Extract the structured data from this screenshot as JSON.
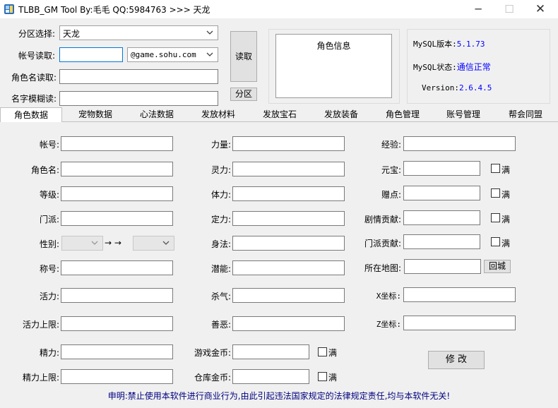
{
  "window": {
    "title": "TLBB_GM Tool By:毛毛 QQ:5984763 >>> 天龙",
    "minimize_label": "─",
    "maximize_label": "☐",
    "close_label": "✕"
  },
  "login": {
    "partition_label": "分区选择:",
    "partition_value": "天龙",
    "account_label": "帐号读取:",
    "account_value": "",
    "domain_value": "@game.sohu.com",
    "role_name_label": "角色名读取:",
    "role_name_value": "",
    "fuzzy_label": "名字模糊读:",
    "fuzzy_value": "",
    "read_button": "读取",
    "partition_button": "分区"
  },
  "role_info": {
    "header": "角色信息"
  },
  "mysql": {
    "version_label": "MySQL版本:",
    "version_value": "5.1.73",
    "status_label": "MySQL状态:",
    "status_value": "通信正常",
    "tool_version_label": "Version:",
    "tool_version_value": "2.6.4.5"
  },
  "tabs": [
    {
      "label": "角色数据",
      "active": true
    },
    {
      "label": "宠物数据",
      "active": false
    },
    {
      "label": "心法数据",
      "active": false
    },
    {
      "label": "发放材料",
      "active": false
    },
    {
      "label": "发放宝石",
      "active": false
    },
    {
      "label": "发放装备",
      "active": false
    },
    {
      "label": "角色管理",
      "active": false
    },
    {
      "label": "账号管理",
      "active": false
    },
    {
      "label": "帮会同盟",
      "active": false
    }
  ],
  "fields": {
    "account": "帐号:",
    "role_name": "角色名:",
    "level": "等级:",
    "sect": "门派:",
    "gender": "性别:",
    "gender_arrow": "→ →",
    "title": "称号:",
    "vitality": "活力:",
    "vitality_max": "活力上限:",
    "energy": "精力:",
    "energy_max": "精力上限:",
    "strength": "力量:",
    "spirit": "灵力:",
    "constitution": "体力:",
    "focus": "定力:",
    "agility": "身法:",
    "potential": "潜能:",
    "kill_aura": "杀气:",
    "good_evil": "善恶:",
    "game_gold": "游戏金币:",
    "bank_gold": "仓库金币:",
    "experience": "经验:",
    "yuanbao": "元宝:",
    "gift_points": "赠点:",
    "story_contrib": "剧情贡献:",
    "sect_contrib": "门派贡献:",
    "map": "所在地图:",
    "x_coord": "X坐标:",
    "z_coord": "Z坐标:"
  },
  "full_label": "满",
  "return_city_button": "回城",
  "modify_button": "修 改",
  "disclaimer": "申明:禁止使用本软件进行商业行为,由此引起违法国家规定的法律规定责任,均与本软件无关!"
}
